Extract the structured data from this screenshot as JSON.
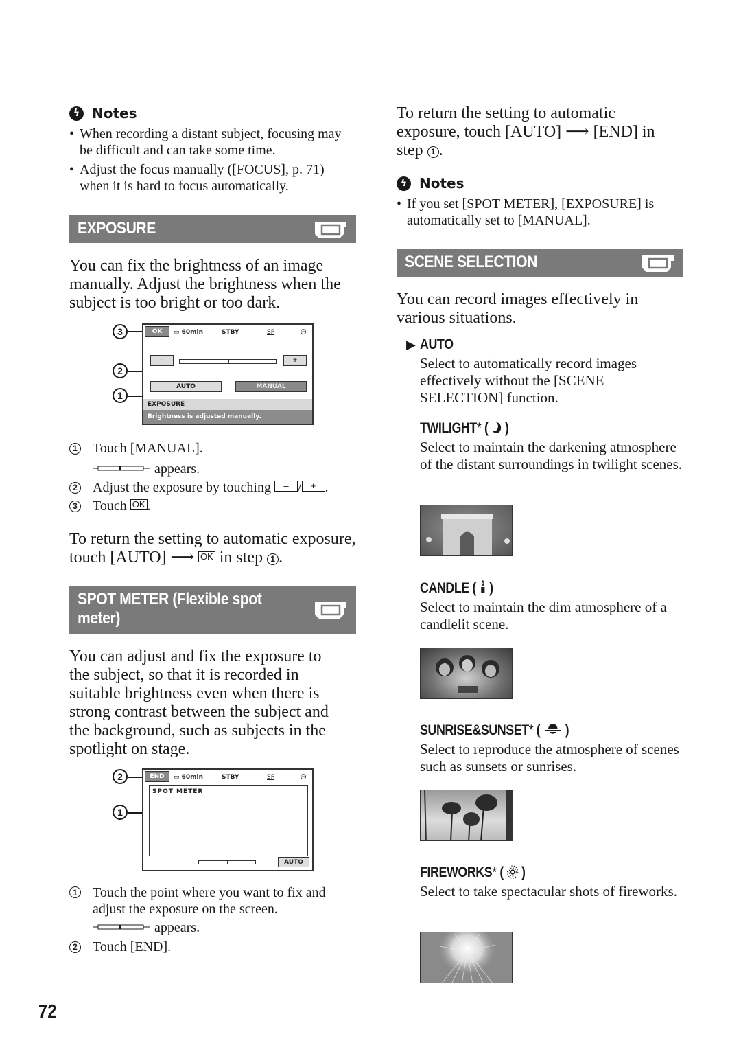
{
  "page_number": "72",
  "left": {
    "notes": {
      "heading": "Notes",
      "icon": "notes-warning-icon",
      "items": [
        "When recording a distant subject, focusing may be difficult and can take some time.",
        "Adjust the focus manually ([FOCUS], p. 71) when it is hard to focus automatically."
      ]
    },
    "exposure": {
      "title": "EXPOSURE",
      "icon": "camcorder-icon",
      "intro": "You can fix the brightness of an image manually. Adjust the brightness when the subject is too bright or too dark.",
      "lcd": {
        "ok": "OK",
        "battery": "60min",
        "status": "STBY",
        "mode": "SP",
        "minus": "–",
        "plus": "+",
        "auto": "AUTO",
        "manual": "MANUAL",
        "caption_title": "EXPOSURE",
        "caption_text": "Brightness is adjusted manually.",
        "callouts": [
          "3",
          "2",
          "1"
        ]
      },
      "steps": [
        {
          "num": "1",
          "text": "Touch [MANUAL].",
          "sub": "appears."
        },
        {
          "num": "2",
          "text_before": "Adjust the exposure by touching",
          "key1": "–",
          "sep": "/",
          "key2": "+",
          "text_after": "."
        },
        {
          "num": "3",
          "text_before": "Touch",
          "key": "OK",
          "text_after": "."
        }
      ],
      "return_before": "To return the setting to automatic exposure, touch [AUTO]",
      "return_key": "OK",
      "return_after": "in step",
      "return_step": "1"
    },
    "spot_meter": {
      "title": "SPOT METER (Flexible spot meter)",
      "icon": "camcorder-icon",
      "intro": "You can adjust and fix the exposure to the subject, so that it is recorded in suitable brightness even when there is strong contrast between the subject and the background, such as subjects in the spotlight on stage.",
      "lcd": {
        "end": "END",
        "battery": "60min",
        "status": "STBY",
        "mode": "SP",
        "label": "SPOT METER",
        "auto": "AUTO",
        "callouts": [
          "2",
          "1"
        ]
      },
      "steps": [
        {
          "num": "1",
          "text": "Touch the point where you want to fix and adjust the exposure on the screen.",
          "sub": "appears."
        },
        {
          "num": "2",
          "text": "Touch [END]."
        }
      ]
    }
  },
  "right": {
    "spot_return_before": "To return the setting to automatic exposure, touch [AUTO]",
    "spot_return_after": "[END] in step",
    "spot_return_step": "1",
    "notes": {
      "heading": "Notes",
      "icon": "notes-warning-icon",
      "items": [
        "If you set [SPOT METER], [EXPOSURE] is automatically set to [MANUAL]."
      ]
    },
    "scene_selection": {
      "title": "SCENE SELECTION",
      "icon": "camcorder-icon",
      "intro": "You can record images effectively in various situations.",
      "options": [
        {
          "name": "AUTO",
          "default": true,
          "icon": "default-arrow-icon",
          "asterisk": false,
          "desc": "Select to automatically record images effectively without the [SCENE SELECTION] function."
        },
        {
          "name": "TWILIGHT",
          "asterisk": true,
          "icon": "moon-icon",
          "desc": "Select to maintain the darkening atmosphere of the distant surroundings in twilight scenes.",
          "image": "arc-de-triomphe-night-photo"
        },
        {
          "name": "CANDLE",
          "asterisk": false,
          "icon": "candle-icon",
          "desc": "Select to maintain the dim atmosphere of a candlelit scene.",
          "image": "birthday-candle-photo"
        },
        {
          "name": "SUNRISE&SUNSET",
          "asterisk": true,
          "icon": "sunset-icon",
          "desc": "Select to reproduce the atmosphere of scenes such as sunsets or sunrises.",
          "image": "palm-trees-sunset-photo"
        },
        {
          "name": "FIREWORKS",
          "asterisk": true,
          "icon": "fireworks-icon",
          "desc": "Select to take spectacular shots of fireworks.",
          "image": "fireworks-photo"
        }
      ]
    }
  },
  "glyphs": {
    "arrow": "⟶",
    "asterisk": "*",
    "triangle": "▶",
    "open_paren": "(",
    "close_paren": ")"
  },
  "colors": {
    "section_bar": "#7a7a7a",
    "text": "#1a1a1a",
    "lcd_caption": "#8c8c8c"
  }
}
